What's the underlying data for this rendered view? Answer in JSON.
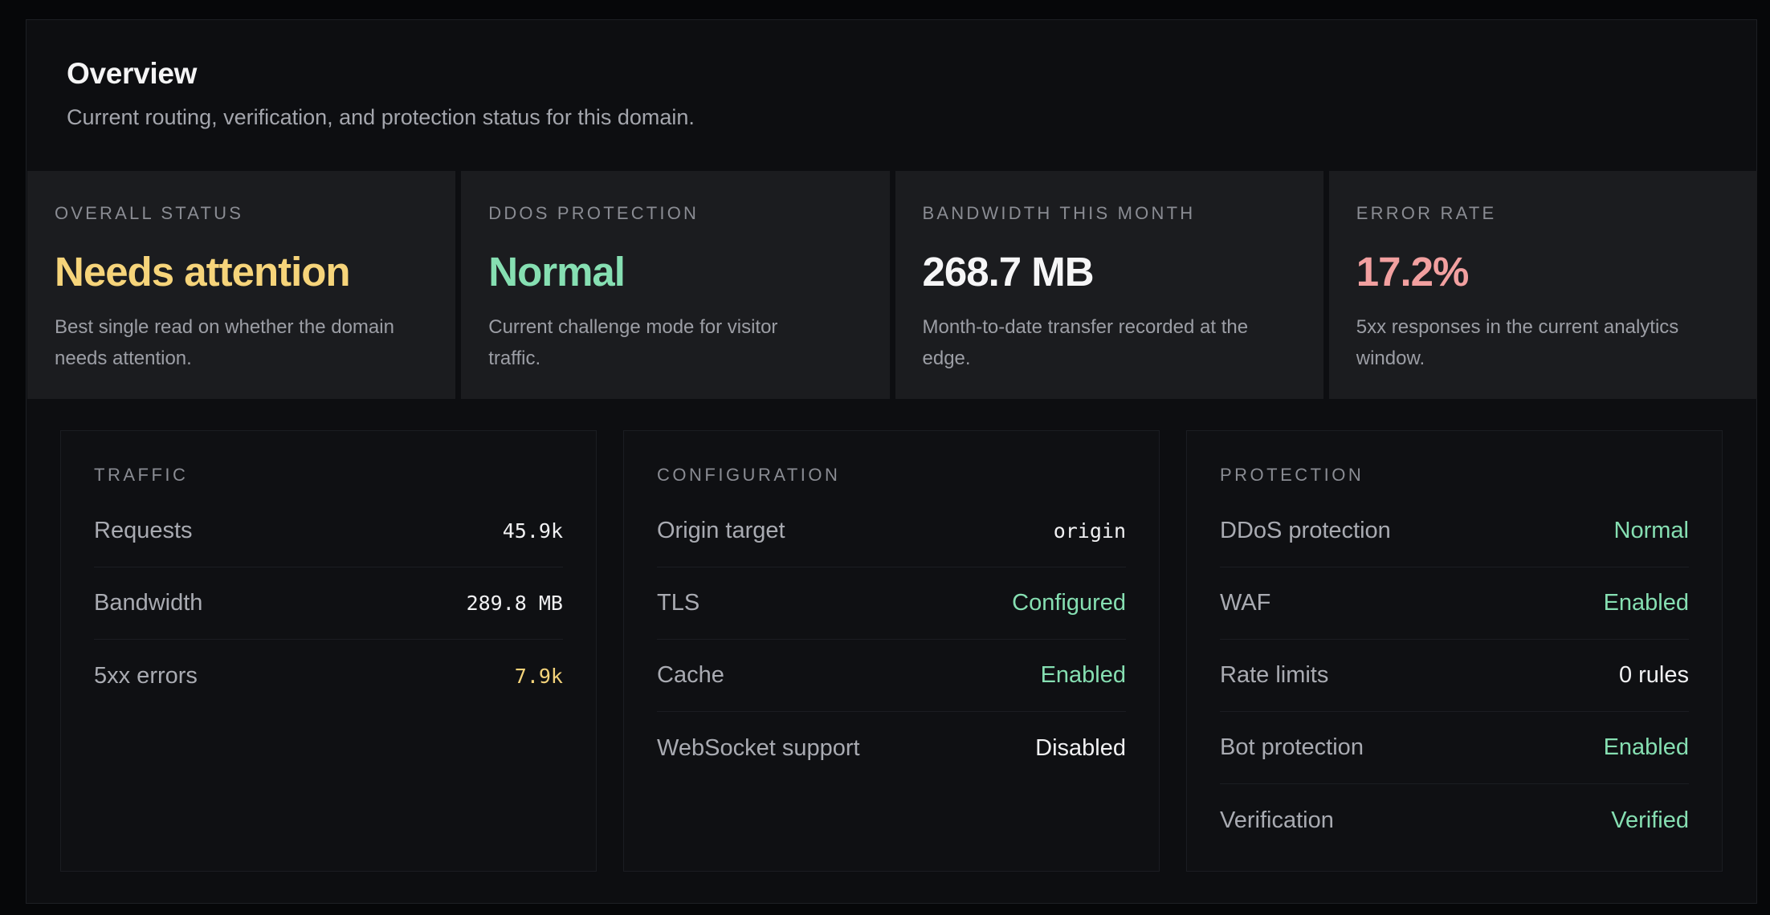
{
  "overview": {
    "title": "Overview",
    "subtitle": "Current routing, verification, and protection status for this domain."
  },
  "stats": [
    {
      "label": "Overall status",
      "value": "Needs attention",
      "desc": "Best single read on whether the domain needs attention.",
      "color": "#f6d47a"
    },
    {
      "label": "DDoS protection",
      "value": "Normal",
      "desc": "Current challenge mode for visitor traffic.",
      "color": "#86dfb2"
    },
    {
      "label": "Bandwidth this month",
      "value": "268.7 MB",
      "desc": "Month-to-date transfer recorded at the edge.",
      "color": "#f6f6f7"
    },
    {
      "label": "Error rate",
      "value": "17.2%",
      "desc": "5xx responses in the current analytics window.",
      "color": "#f2a0a0"
    }
  ],
  "traffic": {
    "title": "Traffic",
    "rows": [
      {
        "label": "Requests",
        "value": "45.9k",
        "color": "#f1f1f3"
      },
      {
        "label": "Bandwidth",
        "value": "289.8 MB",
        "color": "#f1f1f3"
      },
      {
        "label": "5xx errors",
        "value": "7.9k",
        "color": "#f4d37a"
      }
    ]
  },
  "configuration": {
    "title": "Configuration",
    "rows": [
      {
        "label": "Origin target",
        "value": "origin",
        "color": "#f1f1f3"
      },
      {
        "label": "TLS",
        "value": "Configured",
        "color": "#86dfb2"
      },
      {
        "label": "Cache",
        "value": "Enabled",
        "color": "#86dfb2"
      },
      {
        "label": "WebSocket support",
        "value": "Disabled",
        "color": "#f1f1f3"
      }
    ]
  },
  "protection": {
    "title": "Protection",
    "rows": [
      {
        "label": "DDoS protection",
        "value": "Normal",
        "color": "#86dfb2"
      },
      {
        "label": "WAF",
        "value": "Enabled",
        "color": "#86dfb2"
      },
      {
        "label": "Rate limits",
        "value": "0 rules",
        "color": "#f1f1f3"
      },
      {
        "label": "Bot protection",
        "value": "Enabled",
        "color": "#86dfb2"
      },
      {
        "label": "Verification",
        "value": "Verified",
        "color": "#86dfb2"
      }
    ]
  }
}
